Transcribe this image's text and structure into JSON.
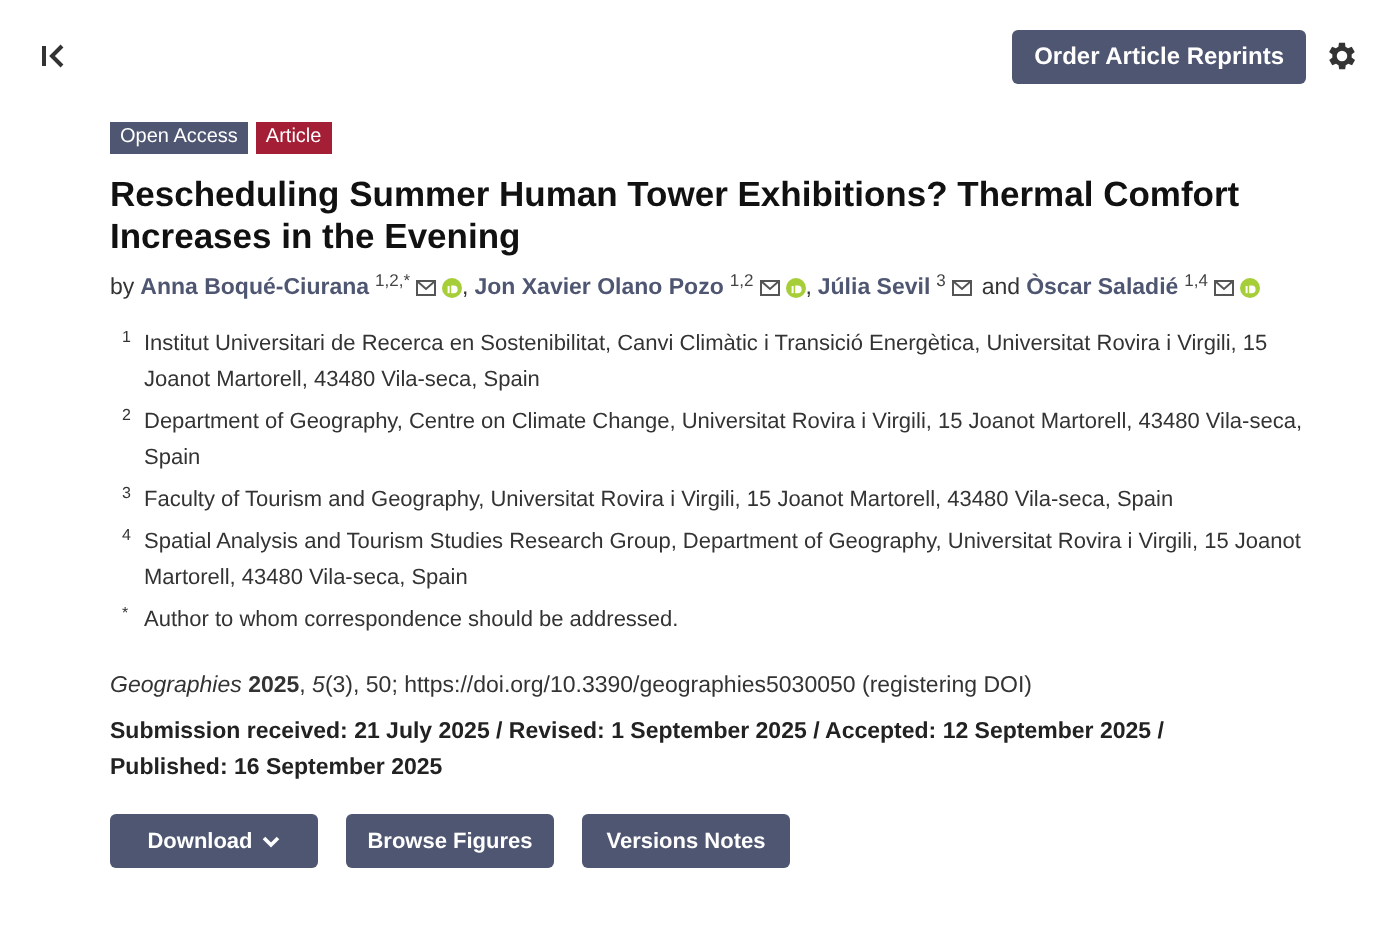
{
  "top_bar": {
    "order_button": "Order Article Reprints"
  },
  "badges": [
    {
      "label": "Open Access",
      "color": "#4f5671"
    },
    {
      "label": "Article",
      "color": "#a41e35"
    }
  ],
  "title": "Rescheduling Summer Human Tower Exhibitions? Thermal Comfort Increases in the Evening",
  "byline_prefix": "by",
  "authors": [
    {
      "name": "Anna Boqué-Ciurana",
      "affiliations": "1,2,*",
      "orcid": true
    },
    {
      "joiner": ",",
      "name": "Jon Xavier Olano Pozo",
      "affiliations": "1,2",
      "orcid": true
    },
    {
      "joiner": ",",
      "name": "Júlia Sevil",
      "affiliations": "3",
      "orcid": false
    },
    {
      "joiner": "and",
      "name": "Òscar Saladié",
      "affiliations": "1,4",
      "orcid": true
    }
  ],
  "affiliations": [
    {
      "mark": "1",
      "text": "Institut Universitari de Recerca en Sostenibilitat, Canvi Climàtic i Transició Energètica, Universitat Rovira i Virgili, 15 Joanot Martorell, 43480 Vila-seca, Spain"
    },
    {
      "mark": "2",
      "text": "Department of Geography, Centre on Climate Change, Universitat Rovira i Virgili, 15 Joanot Martorell, 43480 Vila-seca, Spain"
    },
    {
      "mark": "3",
      "text": "Faculty of Tourism and Geography, Universitat Rovira i Virgili, 15 Joanot Martorell, 43480 Vila-seca, Spain"
    },
    {
      "mark": "4",
      "text": "Spatial Analysis and Tourism Studies Research Group, Department of Geography, Universitat Rovira i Virgili, 15 Joanot Martorell, 43480 Vila-seca, Spain"
    },
    {
      "mark": "*",
      "text": "Author to whom correspondence should be addressed."
    }
  ],
  "citation": "*Geographies* **2025**, *5*(3), 50; https://doi.org/10.3390/geographies5030050 (registering DOI)",
  "dates": "Submission received: 21 July 2025 / Revised: 1 September 2025 / Accepted: 12 September 2025 / Published: 16 September 2025",
  "actions": [
    {
      "label": "Download",
      "kind": "dropdown"
    },
    {
      "label": "Browse Figures",
      "kind": "plain"
    },
    {
      "label": "Versions Notes",
      "kind": "plain"
    }
  ]
}
